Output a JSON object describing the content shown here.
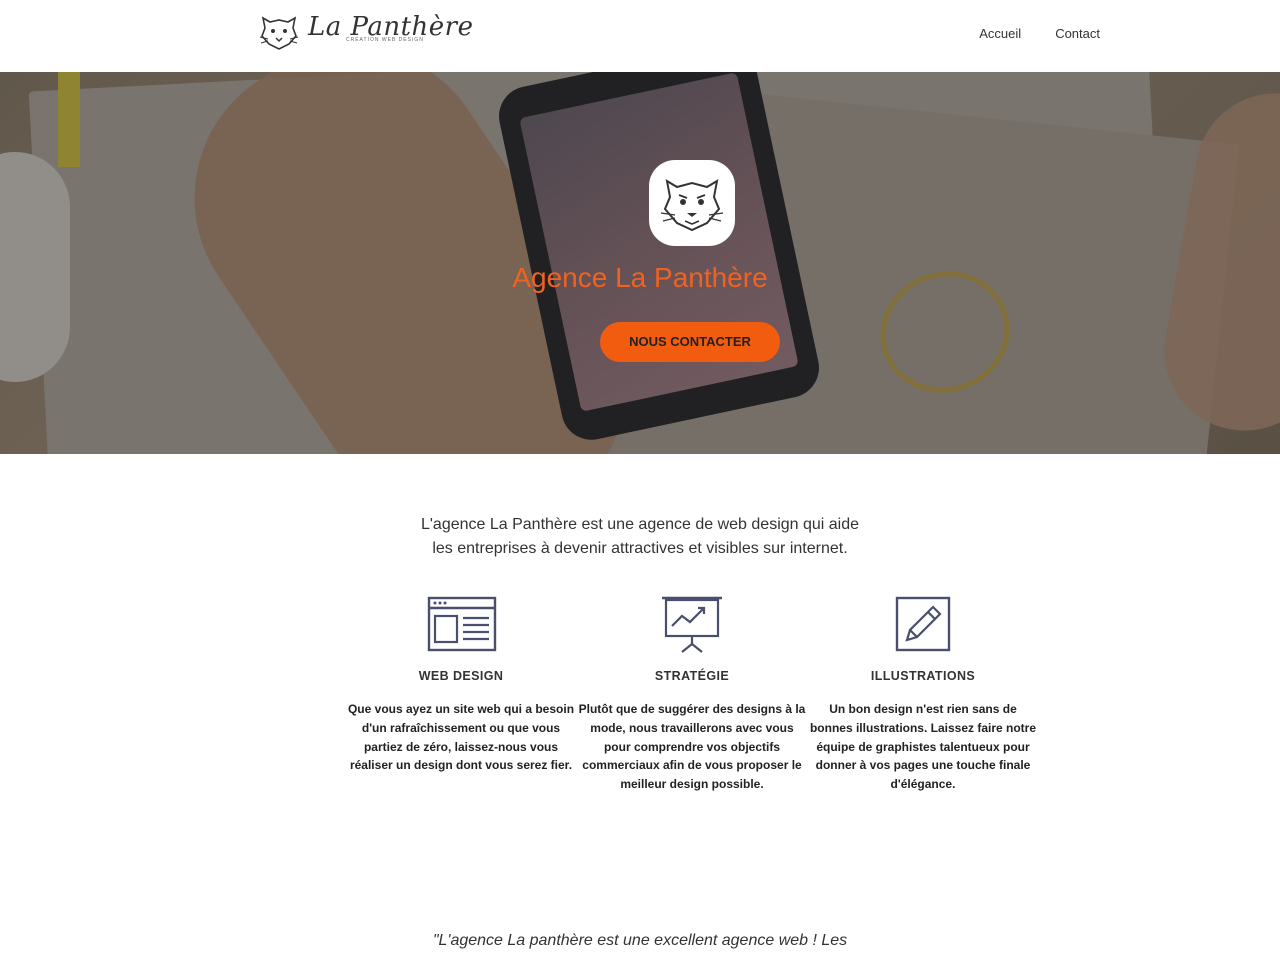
{
  "header": {
    "logo_text": "La Panthère",
    "logo_tagline": "CRÉATION WEB DESIGN",
    "nav": [
      {
        "label": "Accueil"
      },
      {
        "label": "Contact"
      }
    ]
  },
  "hero": {
    "title": "Agence La Panthère",
    "button_label": "NOUS CONTACTER"
  },
  "intro": {
    "line1": "L'agence La Panthère est une agence de web design qui aide",
    "line2": "les entreprises à devenir attractives et visibles sur internet."
  },
  "features": [
    {
      "icon": "browser-window-icon",
      "title": "WEB DESIGN",
      "text": "Que vous ayez un site web qui a besoin d'un rafraîchissement ou que vous partiez de zéro, laissez-nous vous réaliser un design dont vous serez fier."
    },
    {
      "icon": "presentation-chart-icon",
      "title": "STRATÉGIE",
      "text": "Plutôt que de suggérer des designs à la mode, nous travaillerons avec vous pour comprendre vos objectifs commerciaux afin de vous proposer le meilleur design possible."
    },
    {
      "icon": "pencil-edit-icon",
      "title": "ILLUSTRATIONS",
      "text": "Un bon design n'est rien sans de bonnes illustrations. Laissez faire notre équipe de graphistes talentueux pour donner à vos pages une touche finale d'élégance."
    }
  ],
  "testimonial": {
    "text": "\"L'agence La panthère est une excellent agence web ! Les"
  },
  "colors": {
    "accent": "#f25c0f",
    "title_orange": "#f0621f",
    "icon_stroke": "#4a4f6e"
  }
}
